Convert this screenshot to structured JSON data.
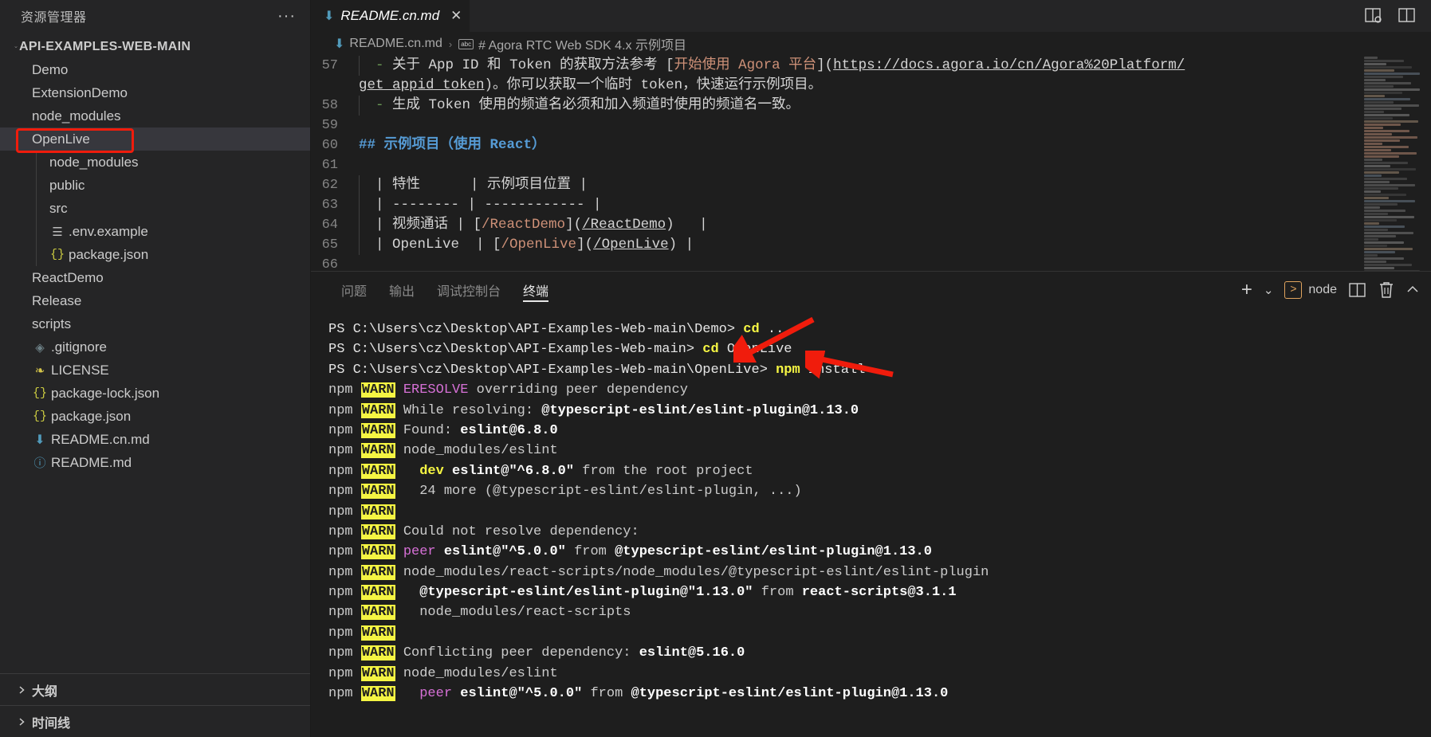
{
  "sidebar": {
    "title": "资源管理器",
    "more_actions": "···",
    "root": {
      "label": "API-EXAMPLES-WEB-MAIN"
    },
    "items": [
      {
        "label": "Demo",
        "type": "folder",
        "indent": 0,
        "expanded": false
      },
      {
        "label": "ExtensionDemo",
        "type": "folder",
        "indent": 0,
        "expanded": false
      },
      {
        "label": "node_modules",
        "type": "folder",
        "indent": 0,
        "expanded": false
      },
      {
        "label": "OpenLive",
        "type": "folder",
        "indent": 0,
        "expanded": true,
        "selected": true,
        "highlighted": true
      },
      {
        "label": "node_modules",
        "type": "folder",
        "indent": 1,
        "expanded": false
      },
      {
        "label": "public",
        "type": "folder",
        "indent": 1,
        "expanded": false
      },
      {
        "label": "src",
        "type": "folder",
        "indent": 1,
        "expanded": false
      },
      {
        "label": ".env.example",
        "type": "text",
        "indent": 1
      },
      {
        "label": "package.json",
        "type": "json",
        "indent": 1
      },
      {
        "label": "ReactDemo",
        "type": "folder",
        "indent": 0,
        "expanded": false
      },
      {
        "label": "Release",
        "type": "folder",
        "indent": 0,
        "expanded": false
      },
      {
        "label": "scripts",
        "type": "folder",
        "indent": 0,
        "expanded": false
      },
      {
        "label": ".gitignore",
        "type": "git",
        "indent": 0
      },
      {
        "label": "LICENSE",
        "type": "license",
        "indent": 0
      },
      {
        "label": "package-lock.json",
        "type": "json",
        "indent": 0
      },
      {
        "label": "package.json",
        "type": "json",
        "indent": 0
      },
      {
        "label": "README.cn.md",
        "type": "markdown",
        "indent": 0
      },
      {
        "label": "README.md",
        "type": "info",
        "indent": 0
      }
    ],
    "sections": [
      {
        "label": "大纲"
      },
      {
        "label": "时间线"
      }
    ]
  },
  "editor": {
    "tab": {
      "label": "README.cn.md",
      "close": "✕",
      "icon": "markdown-down-arrow-icon"
    },
    "breadcrumb": {
      "file": "README.cn.md",
      "separator": "›",
      "symbol_badge": "abc",
      "symbol": "# Agora RTC Web SDK 4.x 示例项目"
    },
    "titlebar_icons": [
      "split-editor-search-icon",
      "split-editor-icon",
      "layout-icon"
    ],
    "lines": [
      {
        "num": "57",
        "segments": [
          {
            "t": "guide"
          },
          {
            "t": "dash",
            "v": "- "
          },
          {
            "t": "txt",
            "v": "关于 "
          },
          {
            "t": "mono",
            "v": "App ID "
          },
          {
            "t": "txt",
            "v": "和 "
          },
          {
            "t": "mono",
            "v": "Token "
          },
          {
            "t": "txt",
            "v": "的获取方法参考 "
          },
          {
            "t": "punct",
            "v": "["
          },
          {
            "t": "link",
            "v": "开始使用 Agora 平台"
          },
          {
            "t": "punct",
            "v": "]("
          },
          {
            "t": "url",
            "v": "https://docs.agora.io/cn/Agora%20Platform/"
          }
        ]
      },
      {
        "num": "",
        "segments": [
          {
            "t": "url",
            "v": "get_appid_token"
          },
          {
            "t": "punct",
            "v": ")"
          },
          {
            "t": "txt",
            "v": "。你可以获取一个临时 "
          },
          {
            "t": "mono",
            "v": "token"
          },
          {
            "t": "txt",
            "v": "，快速运行示例项目。"
          }
        ]
      },
      {
        "num": "58",
        "segments": [
          {
            "t": "guide"
          },
          {
            "t": "dash",
            "v": "- "
          },
          {
            "t": "txt",
            "v": "生成 "
          },
          {
            "t": "mono",
            "v": "Token "
          },
          {
            "t": "txt",
            "v": "使用的频道名必须和加入频道时使用的频道名一致。"
          }
        ]
      },
      {
        "num": "59",
        "segments": []
      },
      {
        "num": "60",
        "segments": [
          {
            "t": "head",
            "v": "## 示例项目（使用 React）"
          }
        ]
      },
      {
        "num": "61",
        "segments": []
      },
      {
        "num": "62",
        "segments": [
          {
            "t": "guide"
          },
          {
            "t": "txt",
            "v": "| 特性      | 示例项目位置 |"
          }
        ]
      },
      {
        "num": "63",
        "segments": [
          {
            "t": "guide"
          },
          {
            "t": "txt",
            "v": "| -------- | ------------ |"
          }
        ]
      },
      {
        "num": "64",
        "segments": [
          {
            "t": "guide"
          },
          {
            "t": "txt",
            "v": "| 视频通话 | "
          },
          {
            "t": "punct",
            "v": "["
          },
          {
            "t": "link",
            "v": "/ReactDemo"
          },
          {
            "t": "punct",
            "v": "]("
          },
          {
            "t": "url",
            "v": "/ReactDemo"
          },
          {
            "t": "punct",
            "v": ")"
          },
          {
            "t": "txt",
            "v": "   |"
          }
        ]
      },
      {
        "num": "65",
        "segments": [
          {
            "t": "guide"
          },
          {
            "t": "txt",
            "v": "| OpenLive  | "
          },
          {
            "t": "punct",
            "v": "["
          },
          {
            "t": "link",
            "v": "/OpenLive"
          },
          {
            "t": "punct",
            "v": "]("
          },
          {
            "t": "url",
            "v": "/OpenLive"
          },
          {
            "t": "punct",
            "v": ")"
          },
          {
            "t": "txt",
            "v": " |"
          }
        ]
      },
      {
        "num": "66",
        "segments": []
      }
    ]
  },
  "panel": {
    "tabs": [
      {
        "label": "问题",
        "active": false
      },
      {
        "label": "输出",
        "active": false
      },
      {
        "label": "调试控制台",
        "active": false
      },
      {
        "label": "终端",
        "active": true
      }
    ],
    "actions": {
      "new_terminal": "+",
      "new_terminal_dropdown": "⌄",
      "terminal_name": "node",
      "split": "split-terminal-icon",
      "kill": "trash-icon",
      "chevron": "⌃"
    }
  },
  "terminal": {
    "lines": [
      {
        "parts": [
          {
            "c": "path",
            "v": "PS C:\\Users\\cz\\Desktop\\API-Examples-Web-main\\Demo> "
          },
          {
            "c": "cmd",
            "v": "cd"
          },
          {
            "c": "arg",
            "v": " .."
          }
        ]
      },
      {
        "parts": [
          {
            "c": "path",
            "v": "PS C:\\Users\\cz\\Desktop\\API-Examples-Web-main> "
          },
          {
            "c": "cmd",
            "v": "cd"
          },
          {
            "c": "arg",
            "v": " OpenLive"
          }
        ]
      },
      {
        "parts": [
          {
            "c": "path",
            "v": "PS C:\\Users\\cz\\Desktop\\API-Examples-Web-main\\OpenLive> "
          },
          {
            "c": "cmd",
            "v": "npm"
          },
          {
            "c": "arg",
            "v": " install"
          }
        ]
      },
      {
        "parts": [
          {
            "c": "npm",
            "v": "npm "
          },
          {
            "c": "warn",
            "v": "WARN"
          },
          {
            "c": "npm",
            "v": " "
          },
          {
            "c": "magenta",
            "v": "ERESOLVE"
          },
          {
            "c": "npm",
            "v": " overriding peer dependency"
          }
        ]
      },
      {
        "parts": [
          {
            "c": "npm",
            "v": "npm "
          },
          {
            "c": "warn",
            "v": "WARN"
          },
          {
            "c": "npm",
            "v": " While resolving: "
          },
          {
            "c": "bold",
            "v": "@typescript-eslint/eslint-plugin@1.13.0"
          }
        ]
      },
      {
        "parts": [
          {
            "c": "npm",
            "v": "npm "
          },
          {
            "c": "warn",
            "v": "WARN"
          },
          {
            "c": "npm",
            "v": " Found: "
          },
          {
            "c": "bold",
            "v": "eslint@6.8.0"
          }
        ]
      },
      {
        "parts": [
          {
            "c": "npm",
            "v": "npm "
          },
          {
            "c": "warn",
            "v": "WARN"
          },
          {
            "c": "npm",
            "v": " node_modules/eslint"
          }
        ]
      },
      {
        "parts": [
          {
            "c": "npm",
            "v": "npm "
          },
          {
            "c": "warn",
            "v": "WARN"
          },
          {
            "c": "npm",
            "v": "   "
          },
          {
            "c": "dev",
            "v": "dev"
          },
          {
            "c": "npm",
            "v": " "
          },
          {
            "c": "bold",
            "v": "eslint@\"^6.8.0\""
          },
          {
            "c": "npm",
            "v": " from the root project"
          }
        ]
      },
      {
        "parts": [
          {
            "c": "npm",
            "v": "npm "
          },
          {
            "c": "warn",
            "v": "WARN"
          },
          {
            "c": "npm",
            "v": "   24 more (@typescript-eslint/eslint-plugin, ...)"
          }
        ]
      },
      {
        "parts": [
          {
            "c": "npm",
            "v": "npm "
          },
          {
            "c": "warn",
            "v": "WARN"
          }
        ]
      },
      {
        "parts": [
          {
            "c": "npm",
            "v": "npm "
          },
          {
            "c": "warn",
            "v": "WARN"
          },
          {
            "c": "npm",
            "v": " Could not resolve dependency:"
          }
        ]
      },
      {
        "parts": [
          {
            "c": "npm",
            "v": "npm "
          },
          {
            "c": "warn",
            "v": "WARN"
          },
          {
            "c": "npm",
            "v": " "
          },
          {
            "c": "magenta",
            "v": "peer"
          },
          {
            "c": "npm",
            "v": " "
          },
          {
            "c": "bold",
            "v": "eslint@\"^5.0.0\""
          },
          {
            "c": "npm",
            "v": " from "
          },
          {
            "c": "bold",
            "v": "@typescript-eslint/eslint-plugin@1.13.0"
          }
        ]
      },
      {
        "parts": [
          {
            "c": "npm",
            "v": "npm "
          },
          {
            "c": "warn",
            "v": "WARN"
          },
          {
            "c": "npm",
            "v": " node_modules/react-scripts/node_modules/@typescript-eslint/eslint-plugin"
          }
        ]
      },
      {
        "parts": [
          {
            "c": "npm",
            "v": "npm "
          },
          {
            "c": "warn",
            "v": "WARN"
          },
          {
            "c": "npm",
            "v": "   "
          },
          {
            "c": "bold",
            "v": "@typescript-eslint/eslint-plugin@\"1.13.0\""
          },
          {
            "c": "npm",
            "v": " from "
          },
          {
            "c": "bold",
            "v": "react-scripts@3.1.1"
          }
        ]
      },
      {
        "parts": [
          {
            "c": "npm",
            "v": "npm "
          },
          {
            "c": "warn",
            "v": "WARN"
          },
          {
            "c": "npm",
            "v": "   node_modules/react-scripts"
          }
        ]
      },
      {
        "parts": [
          {
            "c": "npm",
            "v": "npm "
          },
          {
            "c": "warn",
            "v": "WARN"
          }
        ]
      },
      {
        "parts": [
          {
            "c": "npm",
            "v": "npm "
          },
          {
            "c": "warn",
            "v": "WARN"
          },
          {
            "c": "npm",
            "v": " Conflicting peer dependency: "
          },
          {
            "c": "bold",
            "v": "eslint@5.16.0"
          }
        ]
      },
      {
        "parts": [
          {
            "c": "npm",
            "v": "npm "
          },
          {
            "c": "warn",
            "v": "WARN"
          },
          {
            "c": "npm",
            "v": " node_modules/eslint"
          }
        ]
      },
      {
        "parts": [
          {
            "c": "npm",
            "v": "npm "
          },
          {
            "c": "warn",
            "v": "WARN"
          },
          {
            "c": "npm",
            "v": "   "
          },
          {
            "c": "magenta",
            "v": "peer"
          },
          {
            "c": "npm",
            "v": " "
          },
          {
            "c": "bold",
            "v": "eslint@\"^5.0.0\""
          },
          {
            "c": "npm",
            "v": " from "
          },
          {
            "c": "bold",
            "v": "@typescript-eslint/eslint-plugin@1.13.0"
          }
        ]
      }
    ]
  },
  "annotations": {
    "highlight_color": "#f01c0c",
    "arrows": [
      {
        "name": "arrow-to-cd-openlive"
      },
      {
        "name": "arrow-to-npm-install"
      }
    ]
  }
}
